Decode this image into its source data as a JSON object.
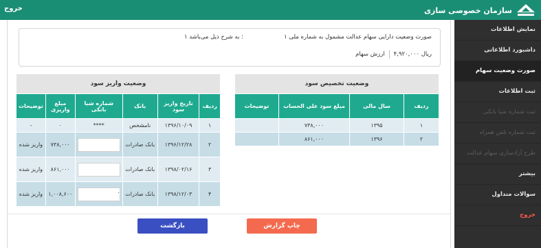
{
  "header": {
    "brand": "سازمان خصوصی سازی",
    "logout": "خروج"
  },
  "sidebar": {
    "items": [
      {
        "label": "نمایش اطلاعات",
        "state": "normal"
      },
      {
        "label": "داشبورد اطلاعاتی",
        "state": "normal"
      },
      {
        "label": "صورت وضعیت سهام",
        "state": "active"
      },
      {
        "label": "ثبت اطلاعات",
        "state": "normal"
      },
      {
        "label": "ثبت شماره شبا بانکی",
        "state": "disabled"
      },
      {
        "label": "ثبت شماره تلفن همراه",
        "state": "disabled"
      },
      {
        "label": "طرح آزادسازی سهام عدالت",
        "state": "disabled"
      },
      {
        "label": "بیشتر",
        "state": "normal"
      },
      {
        "label": "سوالات متداول",
        "state": "normal"
      },
      {
        "label": "خروج",
        "state": "exit"
      }
    ]
  },
  "info": {
    "title": "صورت وضعیت دارایی سهام عدالت مشمول به شماره ملی ۱",
    "title_tail": "۱ به شرح ذیل می‌باشد :",
    "share_value_label": "ارزش سهام",
    "share_value": "۴,۹۲۰,۰۰۰ ریال"
  },
  "allocation": {
    "title": "وضعیت تخصیص سود",
    "headers": [
      "ردیف",
      "سال مالی",
      "مبلغ سود علی الحساب",
      "توضیحات"
    ],
    "rows": [
      [
        "۱",
        "۱۳۹۵",
        "۷۳۸,۰۰۰",
        ""
      ],
      [
        "۲",
        "۱۳۹۶",
        "۸۶۱,۰۰۰",
        ""
      ]
    ]
  },
  "payout": {
    "title": "وضعیت واریز سود",
    "headers": [
      "ردیف",
      "تاریخ واریز سود",
      "بانک",
      "شماره شبا بانکی",
      "مبلغ واریزی",
      "توضیحات"
    ],
    "rows": [
      {
        "row": "۱",
        "date": "۱۳۹۶/۱۰/۰۹",
        "bank": "نامشخص",
        "iban": "****",
        "amount": "۰",
        "note": "-"
      },
      {
        "row": "۲",
        "date": "۱۳۹۶/۱۲/۲۸",
        "bank": "بانک صادرات",
        "iban": "",
        "amount": "۷۳۸,۰۰۰",
        "note": "واریز شده"
      },
      {
        "row": "۳",
        "date": "۱۳۹۸/۰۲/۱۶",
        "bank": "بانک صادرات",
        "iban": "",
        "amount": "۸۶۱,۰۰۰",
        "note": "واریز شده"
      },
      {
        "row": "۴",
        "date": "۱۳۹۸/۱۲/۰۳",
        "bank": "بانک صادرات",
        "iban": ".",
        "amount": "۱,۰۰۸,۶۰۰",
        "note": "واریز شده"
      }
    ]
  },
  "buttons": {
    "print": "چاپ گزارش",
    "back": "بازگشت"
  },
  "colors": {
    "brand_green": "#1a8e75",
    "table_header": "#1faa90",
    "print_button": "#f46a4e",
    "back_button": "#3a4fc1",
    "sidebar_bg": "#2f2f2f"
  }
}
